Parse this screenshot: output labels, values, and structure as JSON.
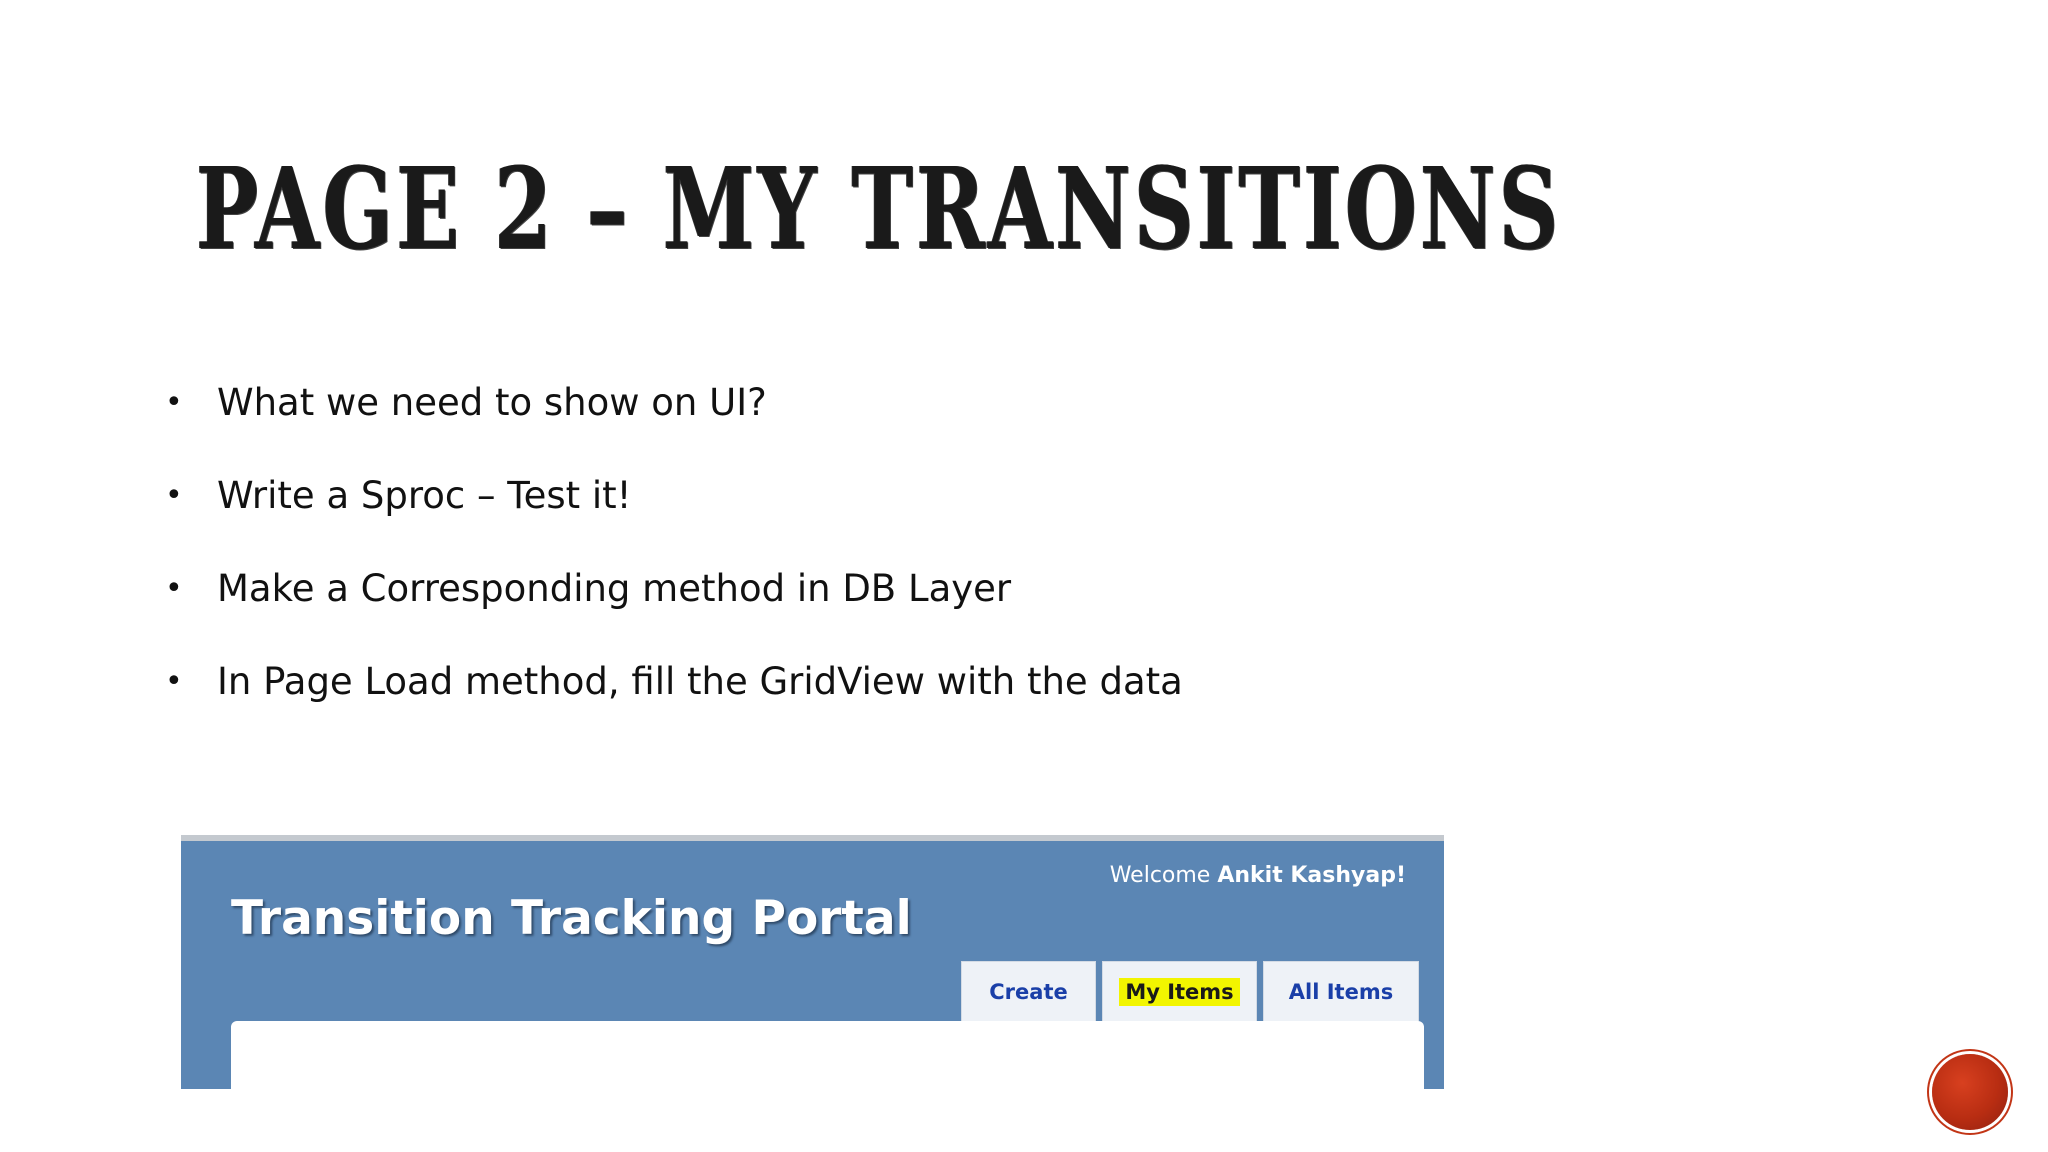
{
  "slide": {
    "title": "Page 2 – My Transitions",
    "bullets": [
      "What we need to show on UI?",
      "Write a Sproc – Test it!",
      "Make a Corresponding method in DB Layer",
      "In Page Load method, fill the GridView with the data"
    ],
    "bullet_glyph": "•"
  },
  "portal": {
    "title": "Transition Tracking Portal",
    "welcome_prefix": "Welcome",
    "welcome_user": "Ankit Kashyap!",
    "tabs": {
      "create": "Create",
      "my_items": "My Items",
      "all_items": "All Items"
    },
    "colors": {
      "header_bg": "#5b86b4",
      "tab_text": "#1a3fa8",
      "highlight": "#f2f500"
    }
  },
  "nav": {
    "icon": "slide-nav-circle-icon",
    "color": "#c23516"
  }
}
